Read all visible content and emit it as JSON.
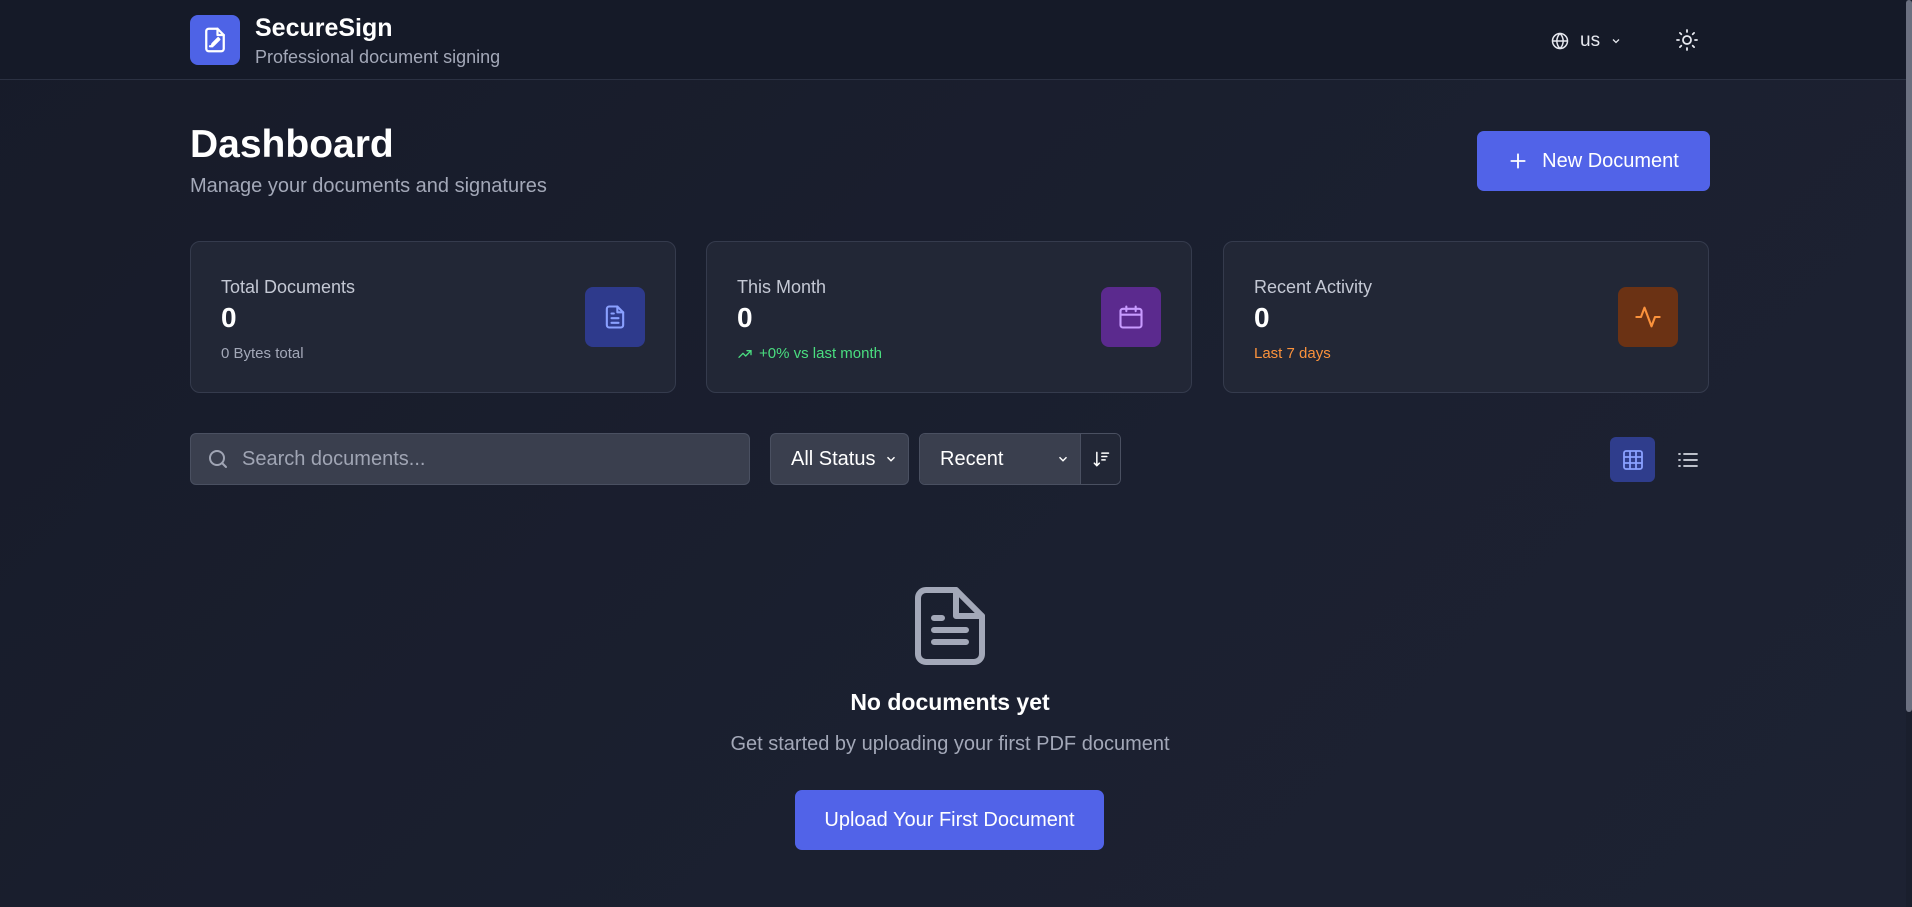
{
  "header": {
    "brand_name": "SecureSign",
    "brand_tagline": "Professional document signing",
    "language": "us"
  },
  "page": {
    "title": "Dashboard",
    "subtitle": "Manage your documents and signatures",
    "new_document_label": "New Document"
  },
  "stats": [
    {
      "label": "Total Documents",
      "value": "0",
      "sub": "0 Bytes total",
      "icon": "file-text-icon",
      "sub_color": "#a3a8b8",
      "icon_bg": "#2e3a8c",
      "icon_color": "#8aa0ff"
    },
    {
      "label": "This Month",
      "value": "0",
      "sub": "+0% vs last month",
      "icon": "calendar-icon",
      "sub_color": "#4ade80",
      "icon_bg": "#5b2a8e",
      "icon_color": "#c89bff"
    },
    {
      "label": "Recent Activity",
      "value": "0",
      "sub": "Last 7 days",
      "icon": "activity-icon",
      "sub_color": "#fb923c",
      "icon_bg": "#6b3214",
      "icon_color": "#fb923c"
    }
  ],
  "filters": {
    "search_placeholder": "Search documents...",
    "status_selected": "All Status",
    "sort_selected": "Recent"
  },
  "empty_state": {
    "title": "No documents yet",
    "subtitle": "Get started by uploading your first PDF document",
    "button_label": "Upload Your First Document"
  },
  "colors": {
    "accent": "#5163e8",
    "background": "#181d2b"
  }
}
